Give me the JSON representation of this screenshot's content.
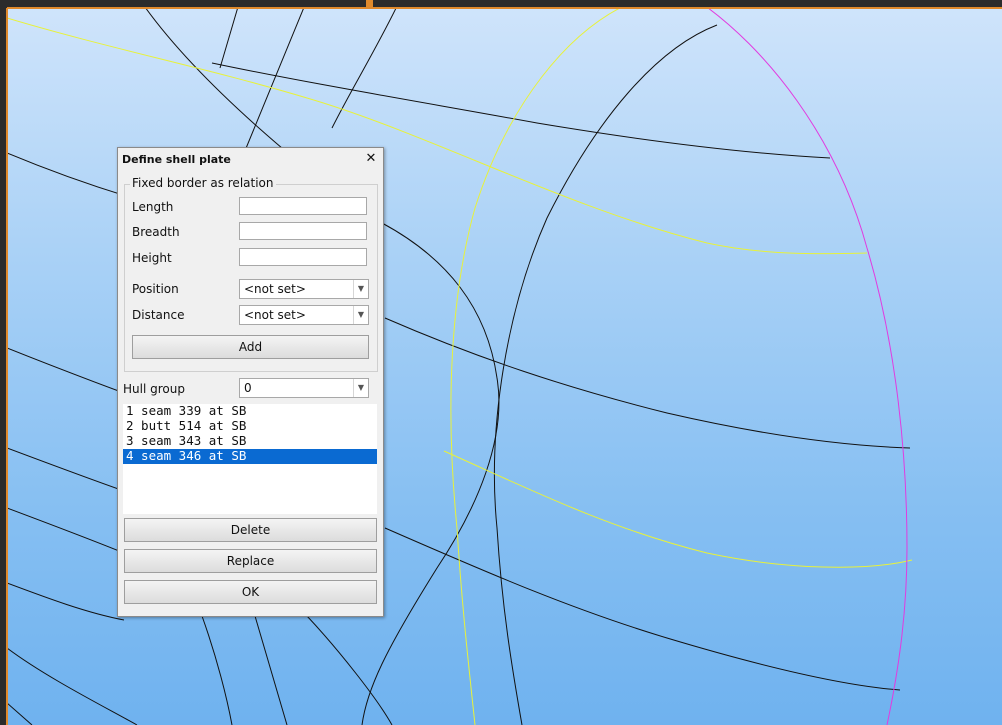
{
  "dialog": {
    "title": "Define shell plate",
    "close_glyph": "✕",
    "groupbox_title": "Fixed border as relation",
    "fields": {
      "length_label": "Length",
      "length_value": "",
      "breadth_label": "Breadth",
      "breadth_value": "",
      "height_label": "Height",
      "height_value": "",
      "position_label": "Position",
      "position_value": "<not set>",
      "distance_label": "Distance",
      "distance_value": "<not set>"
    },
    "add_label": "Add",
    "hull_group_label": "Hull group",
    "hull_group_value": "0",
    "dropdown_glyph": "▼",
    "relations": [
      "1 seam 339 at SB",
      "2 butt 514 at SB",
      "3 seam 343 at SB",
      "4 seam 346 at SB"
    ],
    "selected_relation": 3,
    "delete_label": "Delete",
    "replace_label": "Replace",
    "ok_label": "OK"
  },
  "viewport": {
    "colors": {
      "curve": "#111111",
      "seam": "#e8f23a",
      "boundary": "#e13be0",
      "frame": "#e08a2c"
    }
  }
}
